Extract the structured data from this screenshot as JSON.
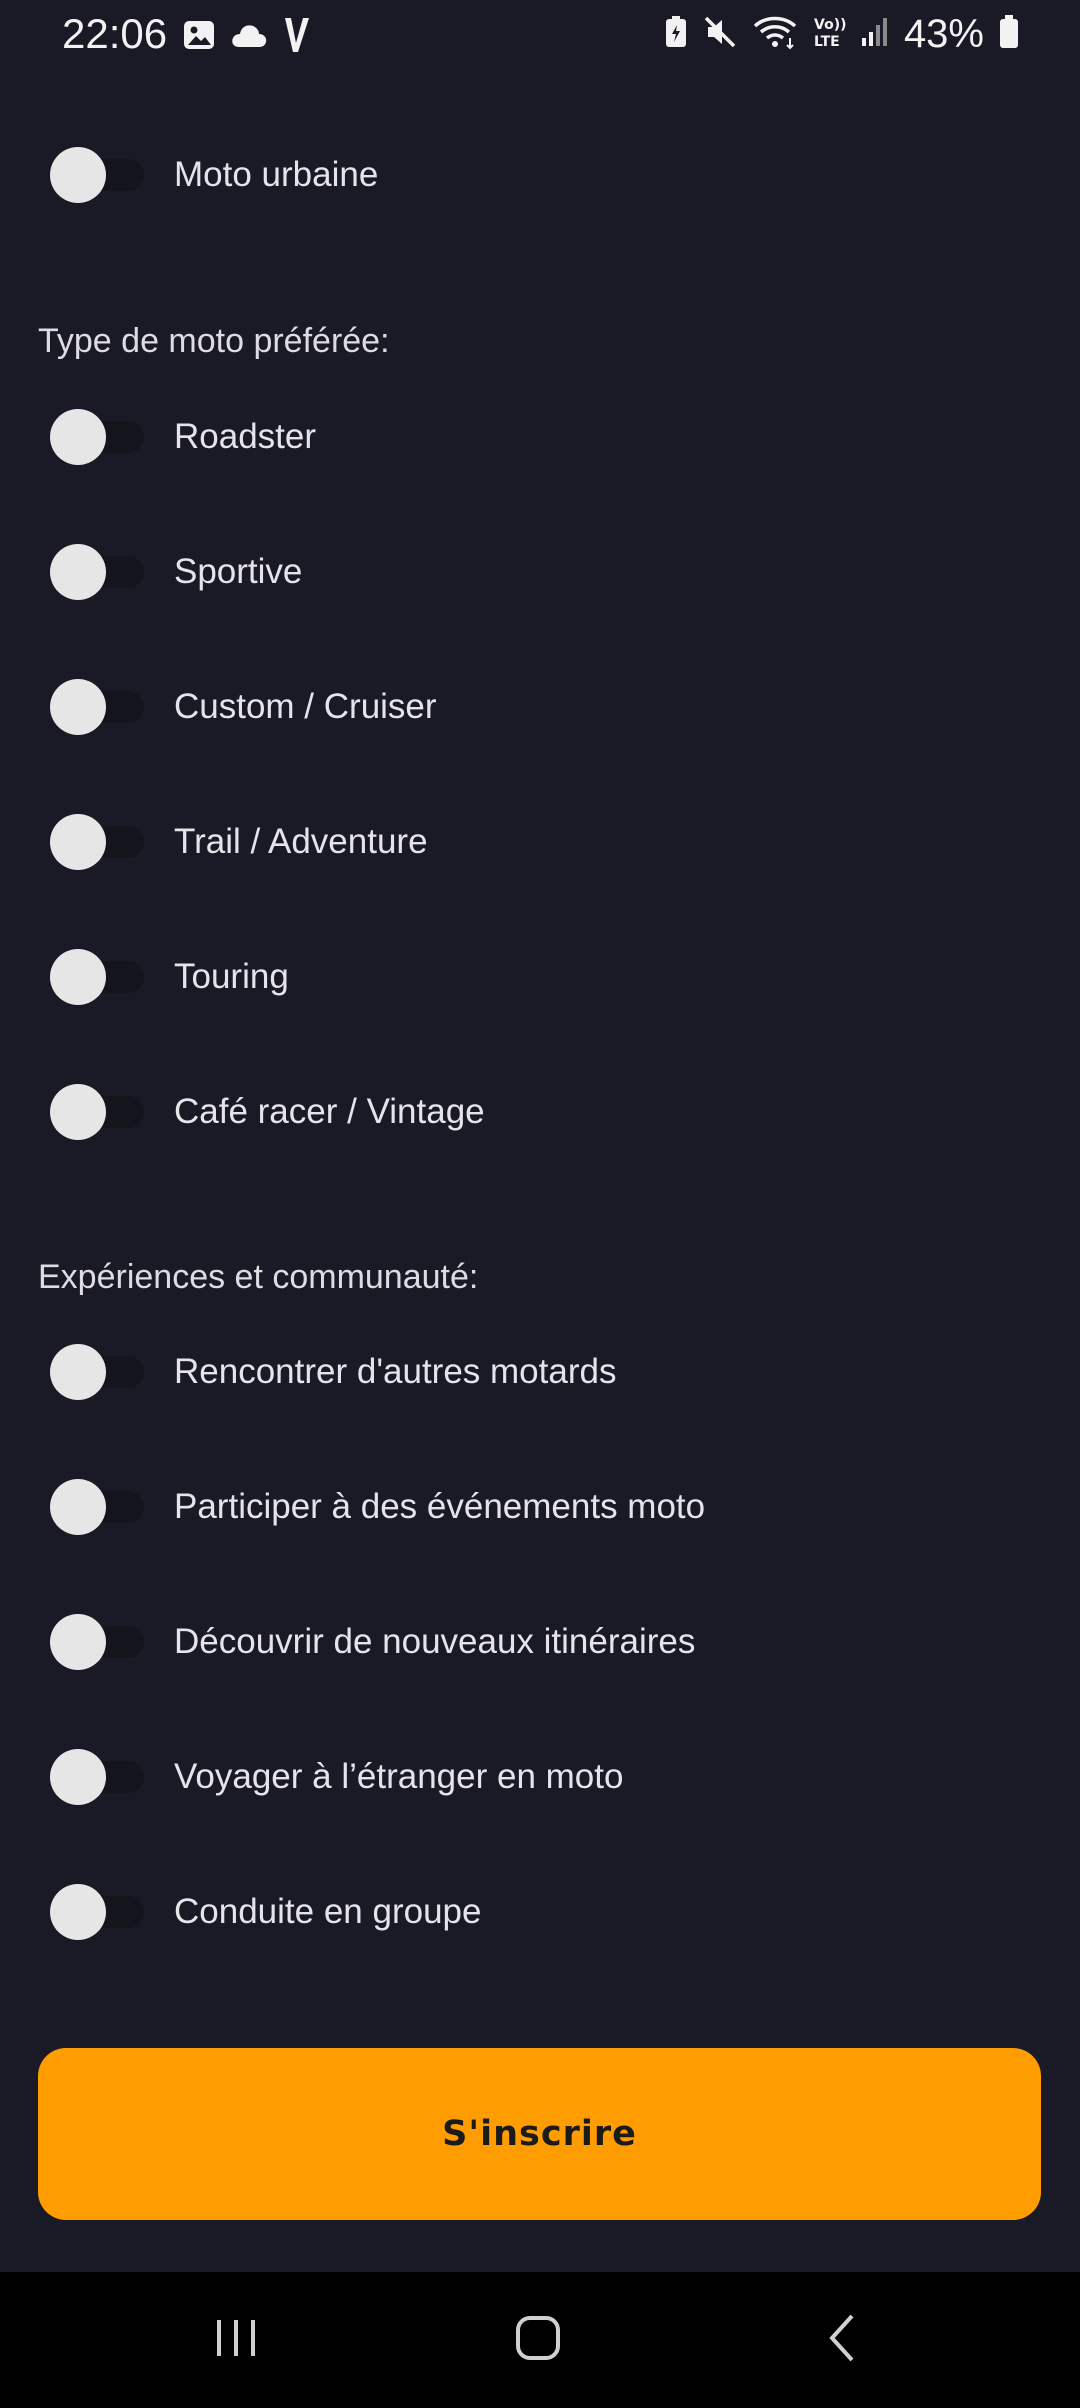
{
  "status_bar": {
    "time": "22:06",
    "battery": "43%",
    "left_icons": [
      "image-icon",
      "cloud-icon",
      "v-app-icon"
    ],
    "right_icons": [
      "battery-saver-icon",
      "mute-icon",
      "wifi-icon",
      "volte-icon",
      "signal-icon",
      "battery-icon"
    ]
  },
  "top_item": {
    "label": "Moto urbaine",
    "checked": false
  },
  "sections": [
    {
      "title": "Type de moto préférée:",
      "items": [
        {
          "label": "Roadster",
          "checked": false
        },
        {
          "label": "Sportive",
          "checked": false
        },
        {
          "label": "Custom / Cruiser",
          "checked": false
        },
        {
          "label": "Trail / Adventure",
          "checked": false
        },
        {
          "label": "Touring",
          "checked": false
        },
        {
          "label": "Café racer / Vintage",
          "checked": false
        }
      ]
    },
    {
      "title": "Expériences et communauté:",
      "items": [
        {
          "label": "Rencontrer d'autres motards",
          "checked": false
        },
        {
          "label": "Participer à des événements moto",
          "checked": false
        },
        {
          "label": "Découvrir de nouveaux itinéraires",
          "checked": false
        },
        {
          "label": "Voyager à l’étranger en moto",
          "checked": false
        },
        {
          "label": "Conduite en groupe",
          "checked": false
        }
      ]
    }
  ],
  "submit": {
    "label": "S'inscrire"
  },
  "colors": {
    "background": "#1a1a26",
    "accent": "#ff9d00",
    "knob": "#e6e6e6",
    "track": "#14141c"
  },
  "nav_bar": {
    "buttons": [
      "recents-icon",
      "home-icon",
      "back-icon"
    ]
  }
}
